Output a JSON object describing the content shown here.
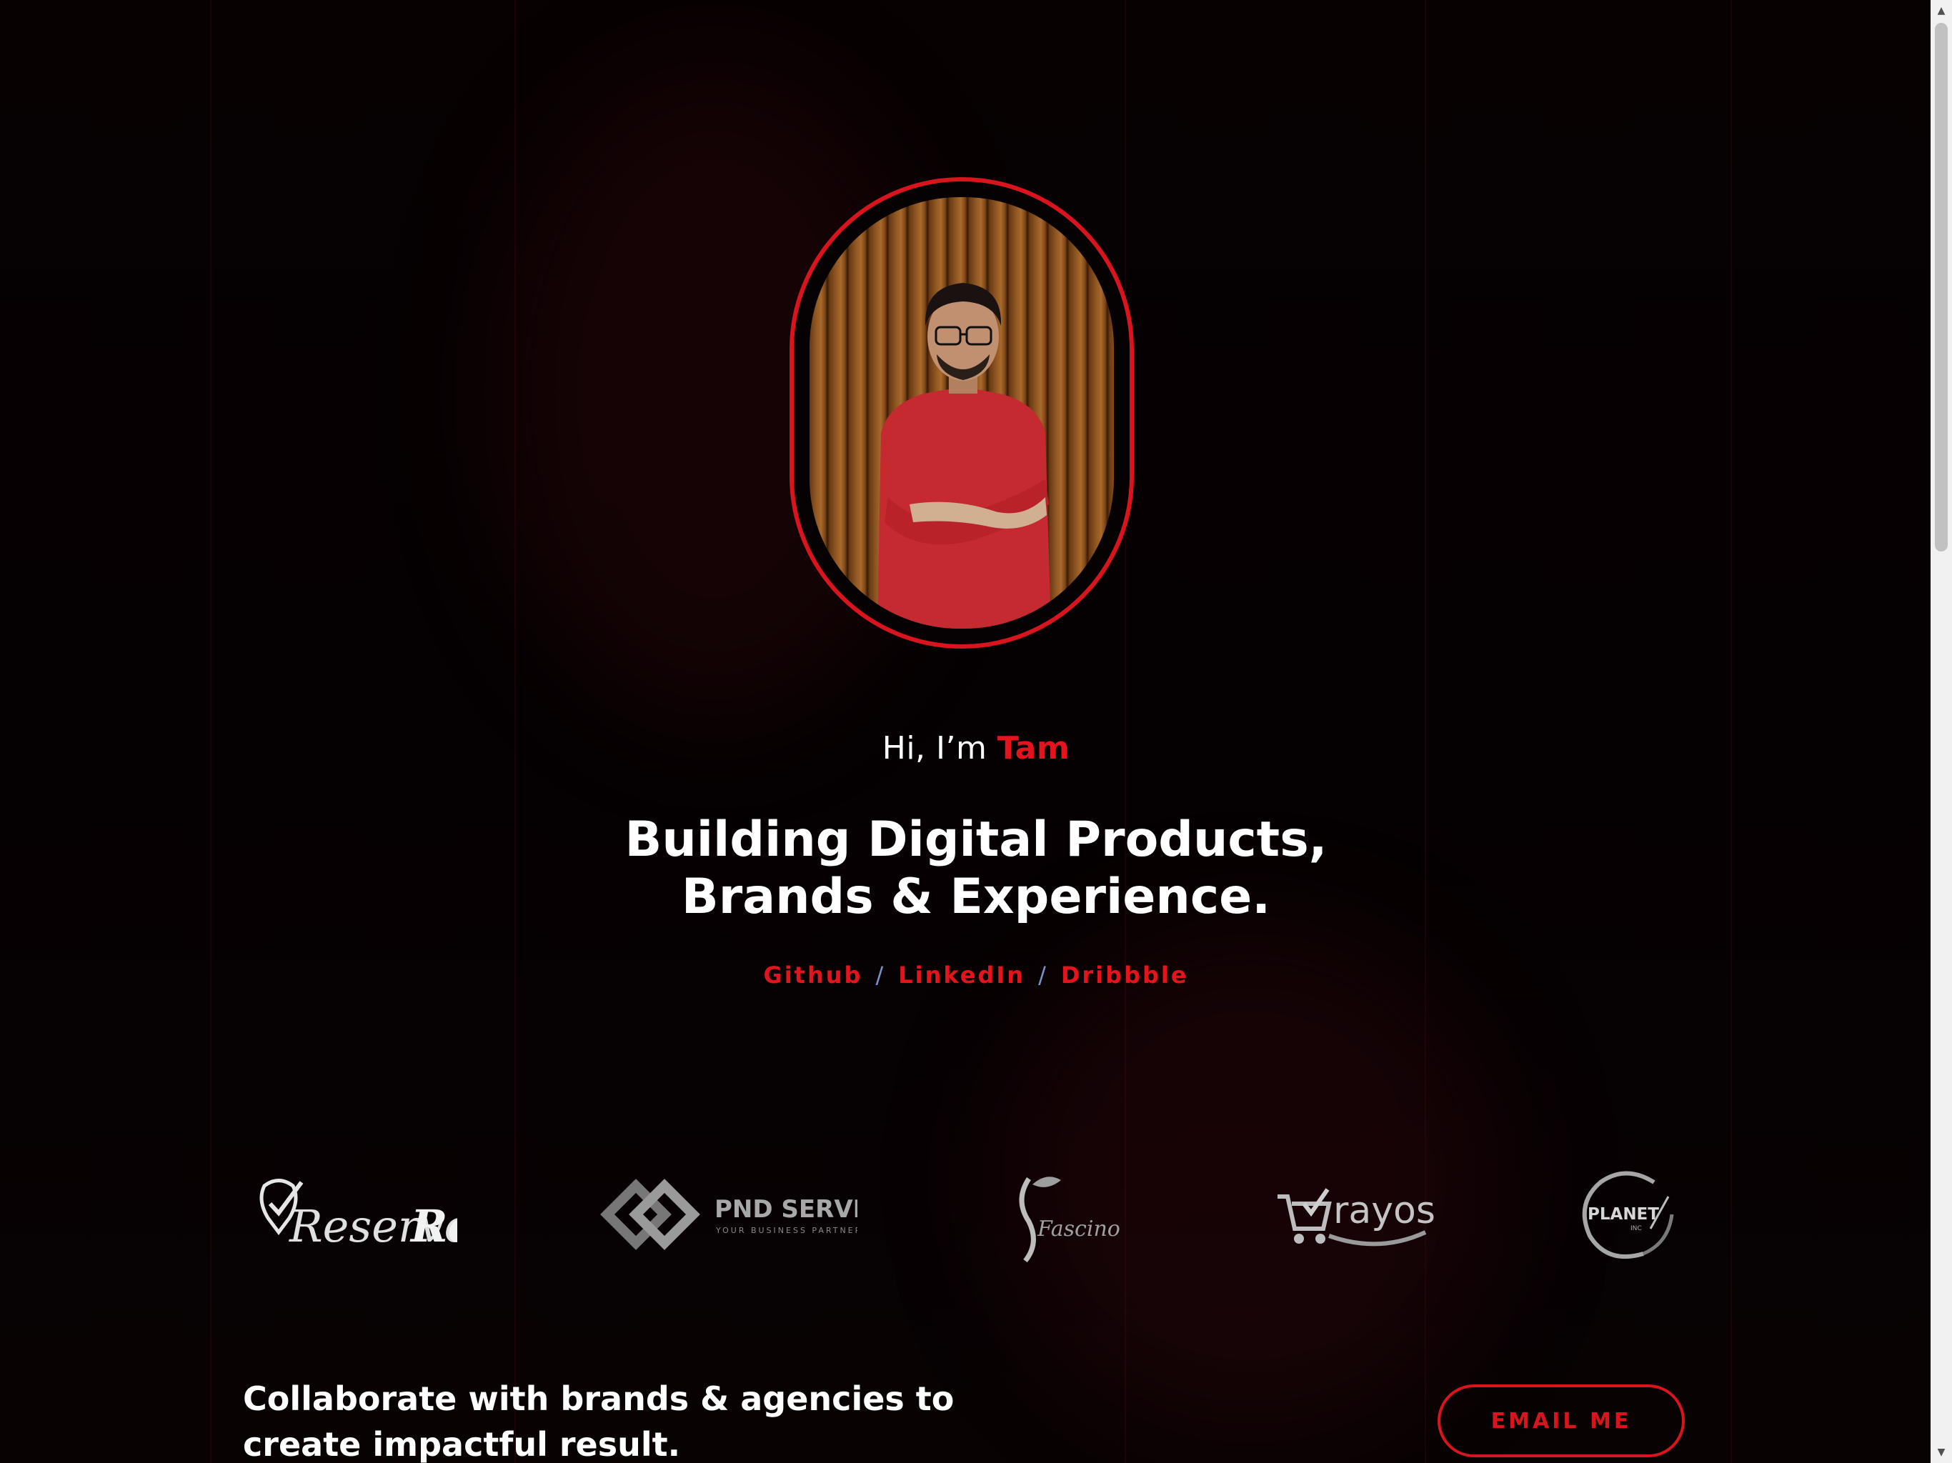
{
  "hero": {
    "greeting_prefix": "Hi, I’m ",
    "name": "Tam",
    "headline_line1": "Building Digital Products,",
    "headline_line2": "Brands & Experience."
  },
  "social": {
    "links": [
      "Github",
      "LinkedIn",
      "Dribbble"
    ],
    "separator": "/"
  },
  "clients": [
    {
      "name": "Reserveit",
      "icon": "reserveit-logo"
    },
    {
      "name": "PND SERVICE",
      "tagline": "YOUR BUSINESS PARTNER",
      "icon": "pnd-service-logo"
    },
    {
      "name": "Fascino",
      "icon": "fascino-logo"
    },
    {
      "name": "rayos",
      "icon": "rayos-logo"
    },
    {
      "name": "PLANET",
      "sub": "INC",
      "icon": "planet-inc-logo"
    }
  ],
  "cta": {
    "text": "Collaborate with brands & agencies to create impactful result.",
    "button_label": "EMAIL ME"
  },
  "colors": {
    "accent": "#d9141c",
    "background": "#060102",
    "separator": "#7a92c6"
  }
}
